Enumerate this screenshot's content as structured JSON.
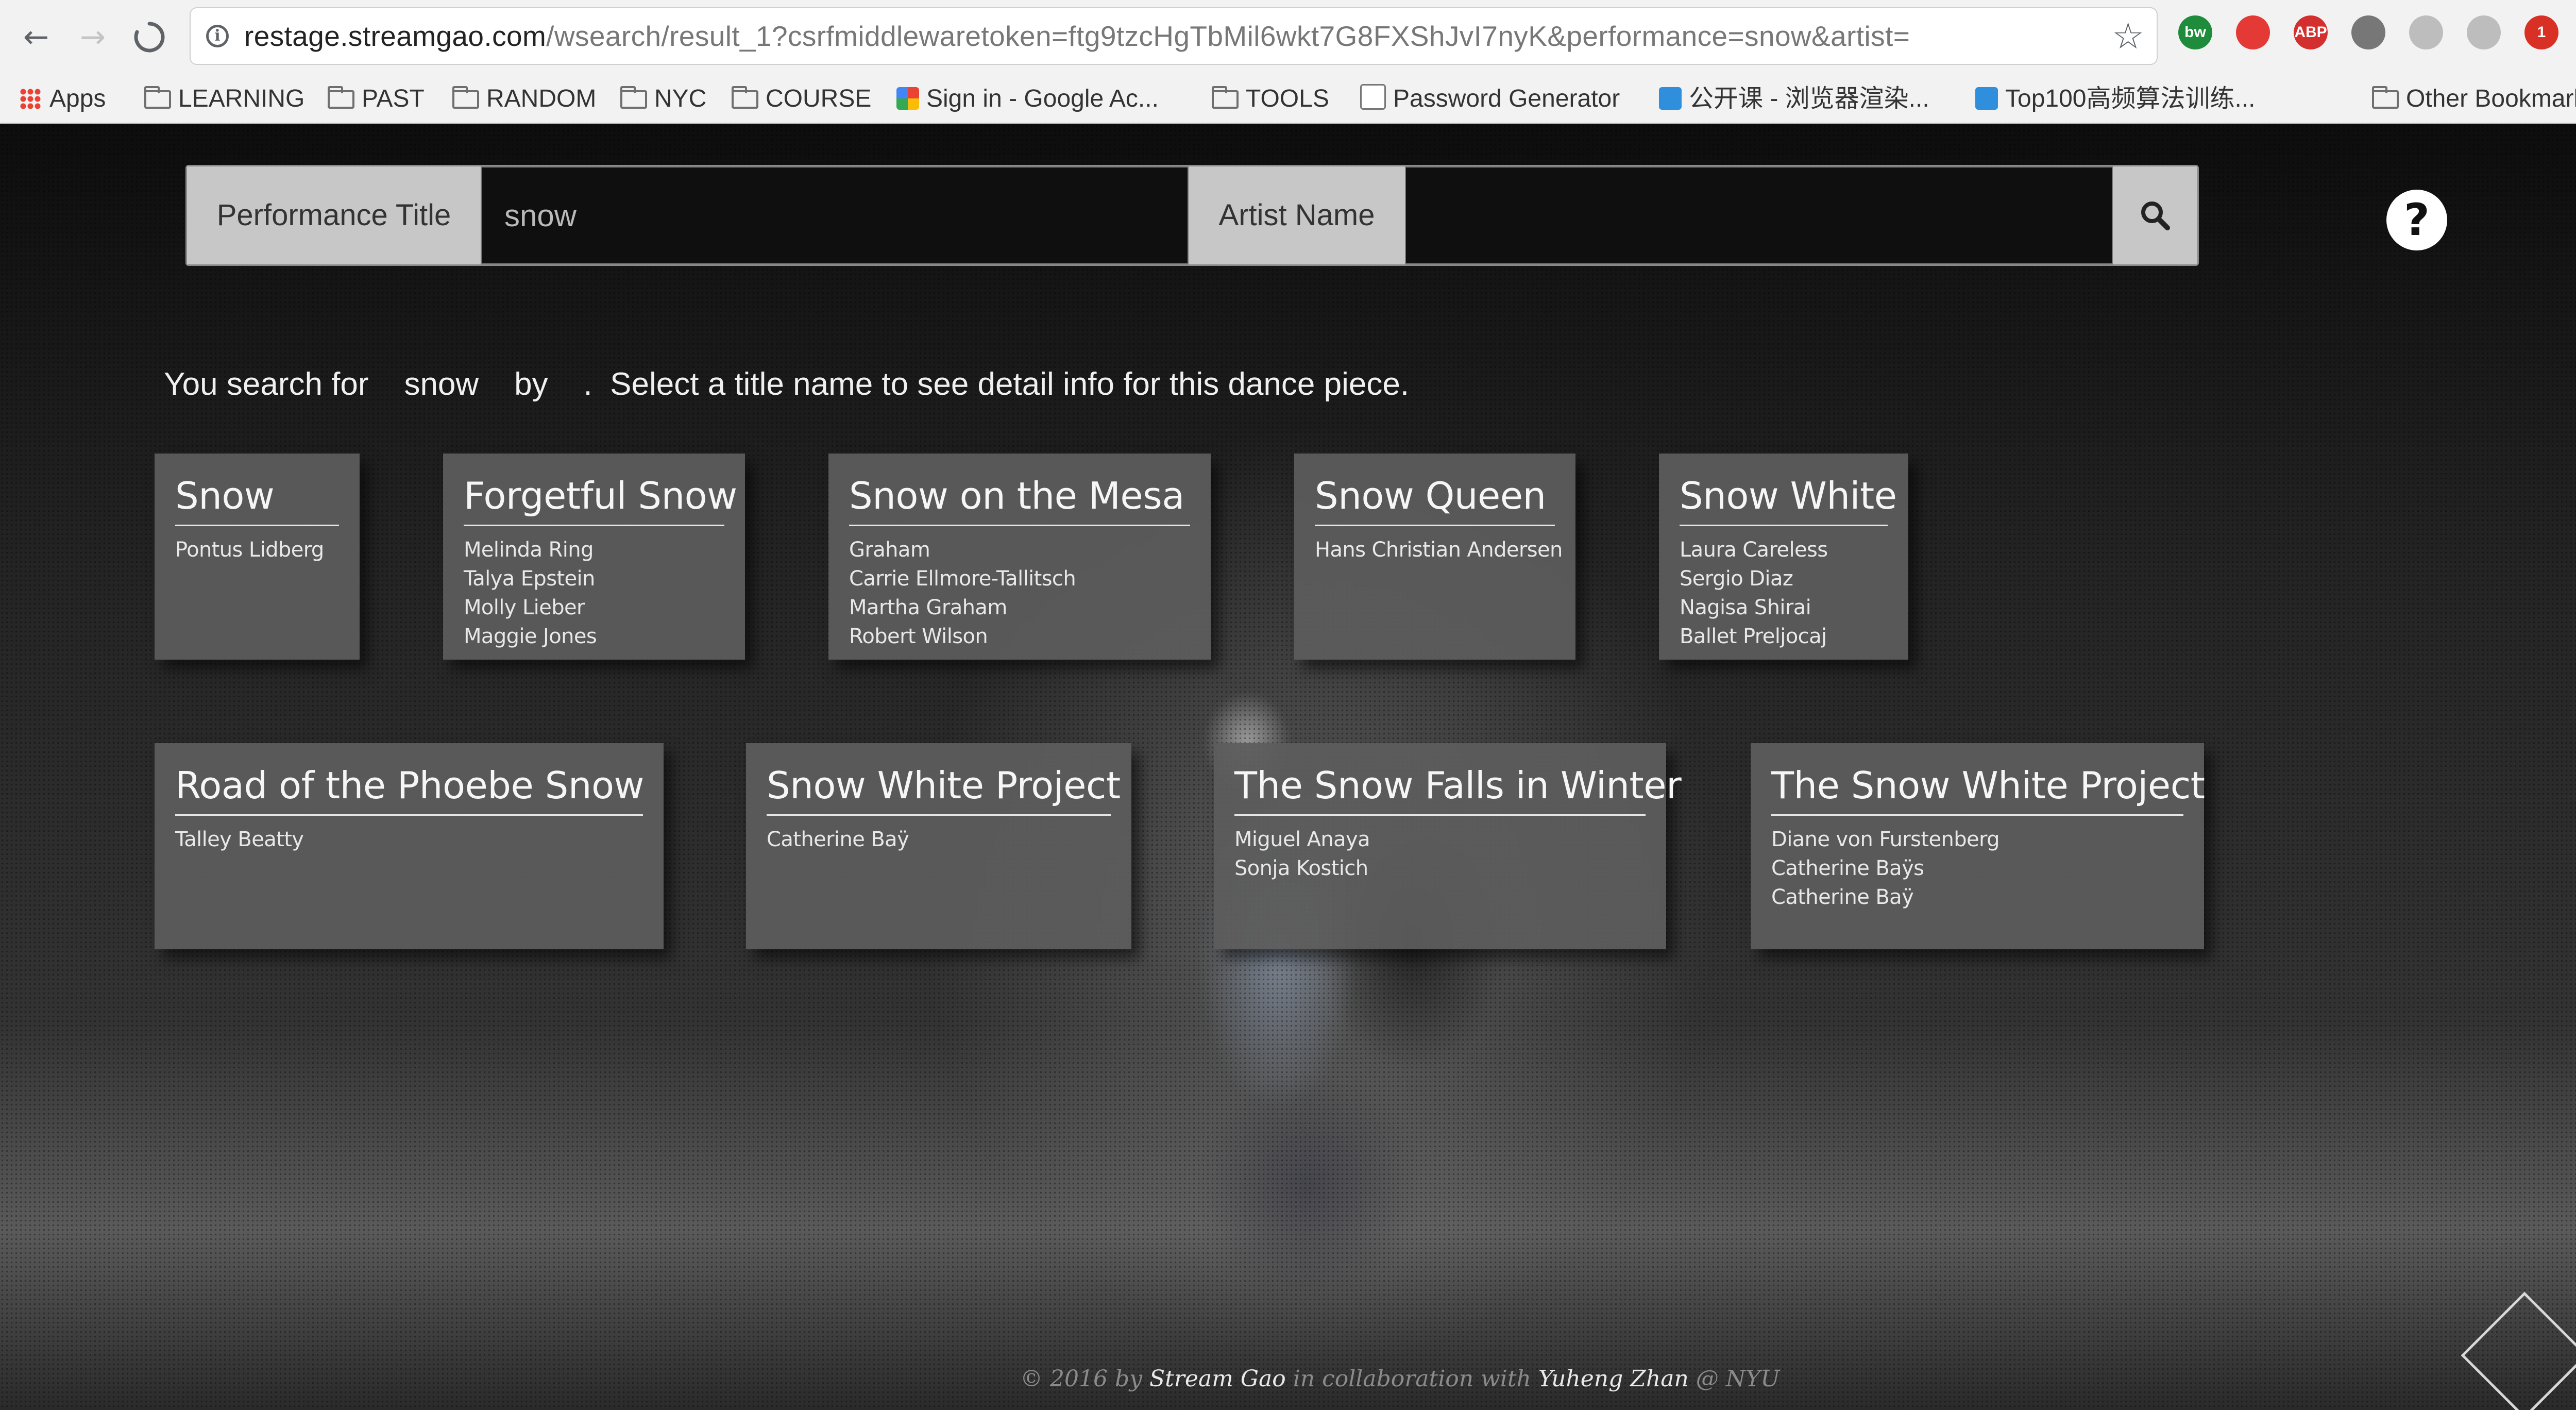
{
  "browser": {
    "url_host": "restage.streamgao.com",
    "url_path": "/wsearch/result_1?csrfmiddlewaretoken=ftg9tzcHgTbMil6wkt7G8FXShJvI7nyK&performance=snow&artist=",
    "extensions": [
      {
        "name": "bw-extension-icon",
        "text": "bw",
        "color": "#1e8c3a"
      },
      {
        "name": "stop-extension-icon",
        "text": "",
        "color": "#e53935"
      },
      {
        "name": "adblock-extension-icon",
        "text": "ABP",
        "color": "#d32f2f"
      },
      {
        "name": "shield-extension-icon",
        "text": "",
        "color": "#777777"
      },
      {
        "name": "react-extension-icon",
        "text": "",
        "color": "#bdbdbd"
      },
      {
        "name": "drive-extension-icon",
        "text": "",
        "color": "#bdbdbd"
      },
      {
        "name": "calendar-extension-icon",
        "text": "1",
        "color": "#d93025"
      }
    ],
    "bookmarks": [
      {
        "label": "Apps",
        "icon": "apps-grid-icon"
      },
      {
        "label": "LEARNING",
        "icon": "folder-icon"
      },
      {
        "label": "PAST",
        "icon": "folder-icon"
      },
      {
        "label": "RANDOM",
        "icon": "folder-icon"
      },
      {
        "label": "NYC",
        "icon": "folder-icon"
      },
      {
        "label": "COURSE",
        "icon": "folder-icon"
      },
      {
        "label": "Sign in - Google Ac...",
        "icon": "google-icon"
      },
      {
        "label": "TOOLS",
        "icon": "folder-icon"
      },
      {
        "label": "Password Generator",
        "icon": "page-icon"
      },
      {
        "label": "公开课 - 浏览器渲染...",
        "icon": "site-icon"
      },
      {
        "label": "Top100高频算法训练...",
        "icon": "site-icon"
      }
    ],
    "other_bookmarks": "Other Bookmarks"
  },
  "search": {
    "performance_label": "Performance Title",
    "performance_value": "snow",
    "artist_label": "Artist Name",
    "artist_value": ""
  },
  "help_label": "?",
  "summary": {
    "prefix": "You search for",
    "query": "snow",
    "by": "by",
    "artist": "",
    "suffix": ".  Select a title name to see detail info for this dance piece."
  },
  "results": [
    {
      "title": "Snow",
      "artists": [
        "Pontus Lidberg"
      ]
    },
    {
      "title": "Forgetful Snow",
      "artists": [
        "Melinda Ring",
        "Talya Epstein",
        "Molly Lieber",
        "Maggie Jones"
      ]
    },
    {
      "title": "Snow on the Mesa",
      "artists": [
        "Graham",
        "Carrie Ellmore-Tallitsch",
        "Martha Graham",
        "Robert Wilson"
      ]
    },
    {
      "title": "Snow Queen",
      "artists": [
        "Hans Christian Andersen"
      ]
    },
    {
      "title": "Snow White",
      "artists": [
        "Laura Careless",
        "Sergio Diaz",
        "Nagisa Shirai",
        "Ballet Preljocaj"
      ]
    },
    {
      "title": "Road of the Phoebe Snow",
      "artists": [
        "Talley Beatty"
      ]
    },
    {
      "title": "Snow White Project",
      "artists": [
        "Catherine Baÿ"
      ]
    },
    {
      "title": "The Snow Falls in Winter",
      "artists": [
        "Miguel Anaya",
        "Sonja Kostich"
      ]
    },
    {
      "title": "The Snow White Project",
      "artists": [
        "Diane von Furstenberg",
        "Catherine Baÿs",
        "Catherine Baÿ"
      ]
    }
  ],
  "footer": {
    "copyright": "© 2016 by",
    "author": "Stream Gao",
    "collab": "in collaboration with",
    "partner": "Yuheng Zhan",
    "org": "@ NYU"
  }
}
